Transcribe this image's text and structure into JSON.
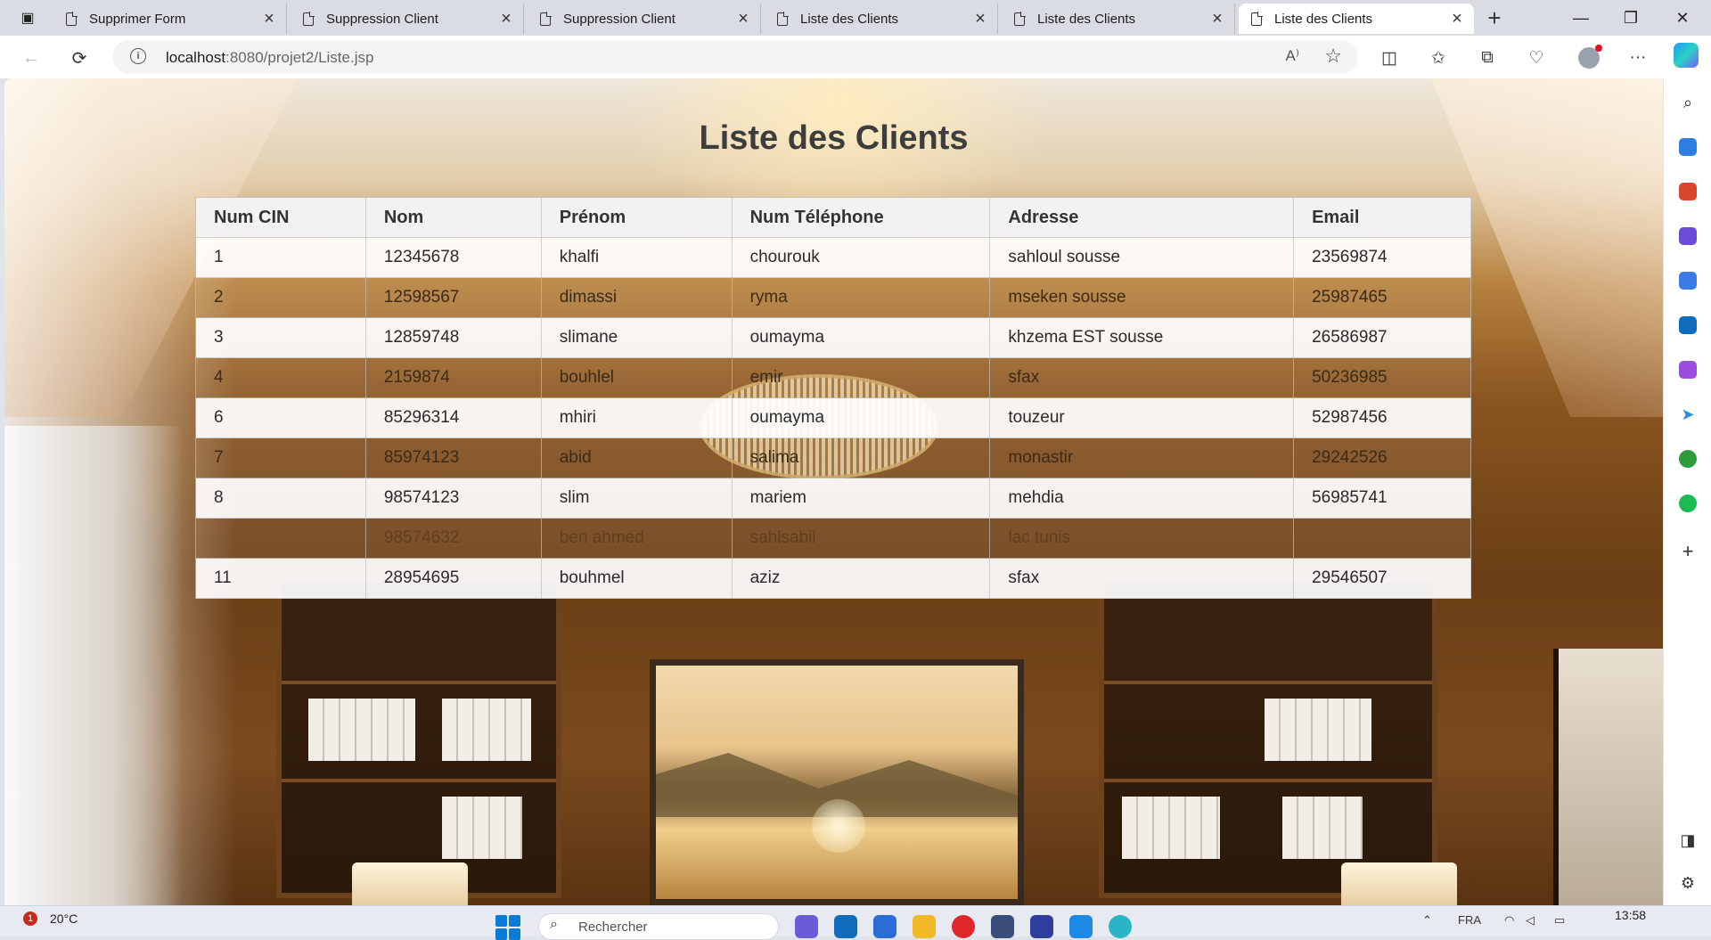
{
  "browser": {
    "tabs": [
      {
        "title": "Supprimer Form",
        "active": false
      },
      {
        "title": "Suppression Client",
        "active": false
      },
      {
        "title": "Suppression Client",
        "active": false
      },
      {
        "title": "Liste des Clients",
        "active": false
      },
      {
        "title": "Liste des Clients",
        "active": false
      },
      {
        "title": "Liste des Clients",
        "active": true
      }
    ],
    "address": {
      "host": "localhost",
      "rest": ":8080/projet2/Liste.jsp"
    }
  },
  "page": {
    "title": "Liste des Clients",
    "table": {
      "headers": [
        "Num CIN",
        "Nom",
        "Prénom",
        "Num Téléphone",
        "Adresse",
        "Email"
      ],
      "rows": [
        [
          "1",
          "12345678",
          "khalfi",
          "chourouk",
          "sahloul sousse",
          "23569874"
        ],
        [
          "2",
          "12598567",
          "dimassi",
          "ryma",
          "mseken sousse",
          "25987465"
        ],
        [
          "3",
          "12859748",
          "slimane",
          "oumayma",
          "khzema EST sousse",
          "26586987"
        ],
        [
          "4",
          "2159874",
          "bouhlel",
          "emir",
          "sfax",
          "50236985"
        ],
        [
          "6",
          "85296314",
          "mhiri",
          "oumayma",
          "touzeur",
          "52987456"
        ],
        [
          "7",
          "85974123",
          "abid",
          "salima",
          "monastir",
          "29242526"
        ],
        [
          "8",
          "98574123",
          "slim",
          "mariem",
          "mehdia",
          "56985741"
        ],
        [
          "",
          "98574632",
          "ben ahmed",
          "sahlsabil",
          "lac tunis",
          ""
        ],
        [
          "11",
          "28954695",
          "bouhmel",
          "aziz",
          "sfax",
          "29546507"
        ]
      ]
    }
  },
  "taskbar": {
    "weather": "20°C",
    "notification_count": "1",
    "search_placeholder": "Rechercher",
    "language": "FRA",
    "time": "13:58"
  }
}
